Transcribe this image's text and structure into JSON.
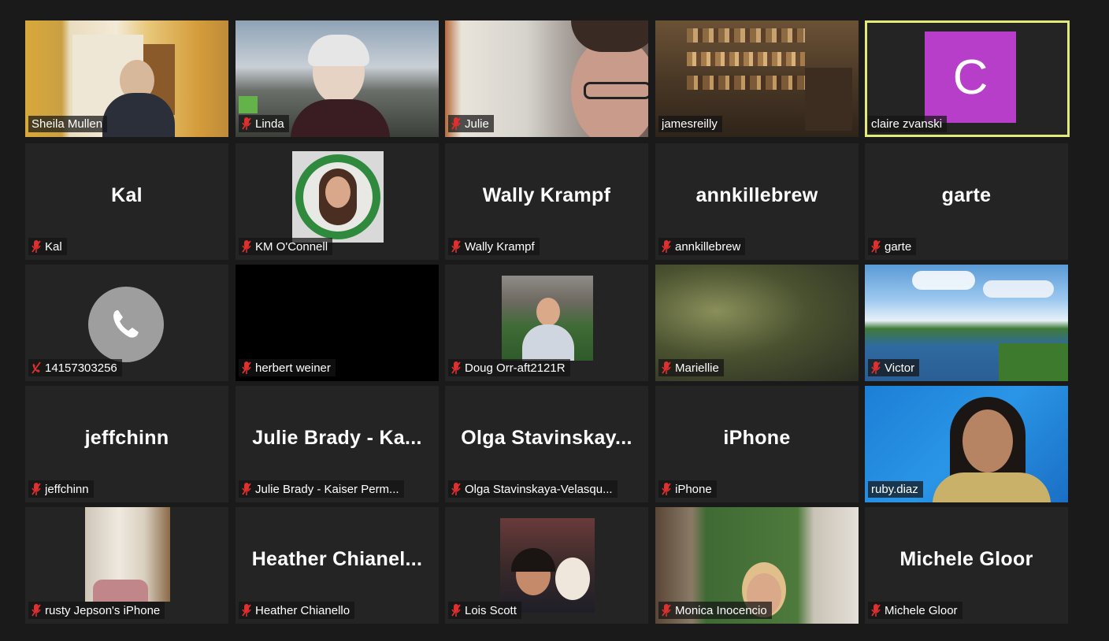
{
  "meeting": {
    "accent_color": "#e2eb7a",
    "tile_bg": "#242424",
    "muted_color": "#e0302e",
    "participants": [
      {
        "display": "Sheila Mullen",
        "big": "",
        "muted": false,
        "kind": "video"
      },
      {
        "display": "Linda",
        "big": "",
        "muted": true,
        "kind": "video"
      },
      {
        "display": "Julie",
        "big": "",
        "muted": true,
        "kind": "video"
      },
      {
        "display": "jamesreilly",
        "big": "",
        "muted": false,
        "kind": "video"
      },
      {
        "display": "claire zvanski",
        "big": "",
        "muted": false,
        "kind": "avatar",
        "avatar_letter": "C",
        "avatar_color": "#b73ec9",
        "active_speaker": true
      },
      {
        "display": "Kal",
        "big": "Kal",
        "muted": true,
        "kind": "name"
      },
      {
        "display": "KM O'Connell",
        "big": "",
        "muted": true,
        "kind": "photo"
      },
      {
        "display": "Wally Krampf",
        "big": "Wally Krampf",
        "muted": true,
        "kind": "name"
      },
      {
        "display": "annkillebrew",
        "big": "annkillebrew",
        "muted": true,
        "kind": "name"
      },
      {
        "display": "garte",
        "big": "garte",
        "muted": true,
        "kind": "name"
      },
      {
        "display": "14157303256",
        "big": "",
        "muted": true,
        "kind": "phone"
      },
      {
        "display": "herbert weiner",
        "big": "",
        "muted": true,
        "kind": "black"
      },
      {
        "display": "Doug Orr-aft2121R",
        "big": "",
        "muted": true,
        "kind": "photo"
      },
      {
        "display": "Mariellie",
        "big": "",
        "muted": true,
        "kind": "video"
      },
      {
        "display": "Victor",
        "big": "",
        "muted": true,
        "kind": "video"
      },
      {
        "display": "jeffchinn",
        "big": "jeffchinn",
        "muted": true,
        "kind": "name"
      },
      {
        "display": "Julie Brady - Kaiser Perm...",
        "big": "Julie Brady - Ka...",
        "muted": true,
        "kind": "name"
      },
      {
        "display": "Olga Stavinskaya-Velasqu...",
        "big": "Olga Stavinskay...",
        "muted": true,
        "kind": "name"
      },
      {
        "display": "iPhone",
        "big": "iPhone",
        "muted": true,
        "kind": "name"
      },
      {
        "display": "ruby.diaz",
        "big": "",
        "muted": false,
        "kind": "video"
      },
      {
        "display": "rusty Jepson's iPhone",
        "big": "",
        "muted": true,
        "kind": "photo"
      },
      {
        "display": "Heather Chianello",
        "big": "Heather Chianel...",
        "muted": true,
        "kind": "name"
      },
      {
        "display": "Lois Scott",
        "big": "",
        "muted": true,
        "kind": "photo"
      },
      {
        "display": "Monica Inocencio",
        "big": "",
        "muted": true,
        "kind": "photo"
      },
      {
        "display": "Michele Gloor",
        "big": "Michele Gloor",
        "muted": true,
        "kind": "name"
      }
    ]
  }
}
